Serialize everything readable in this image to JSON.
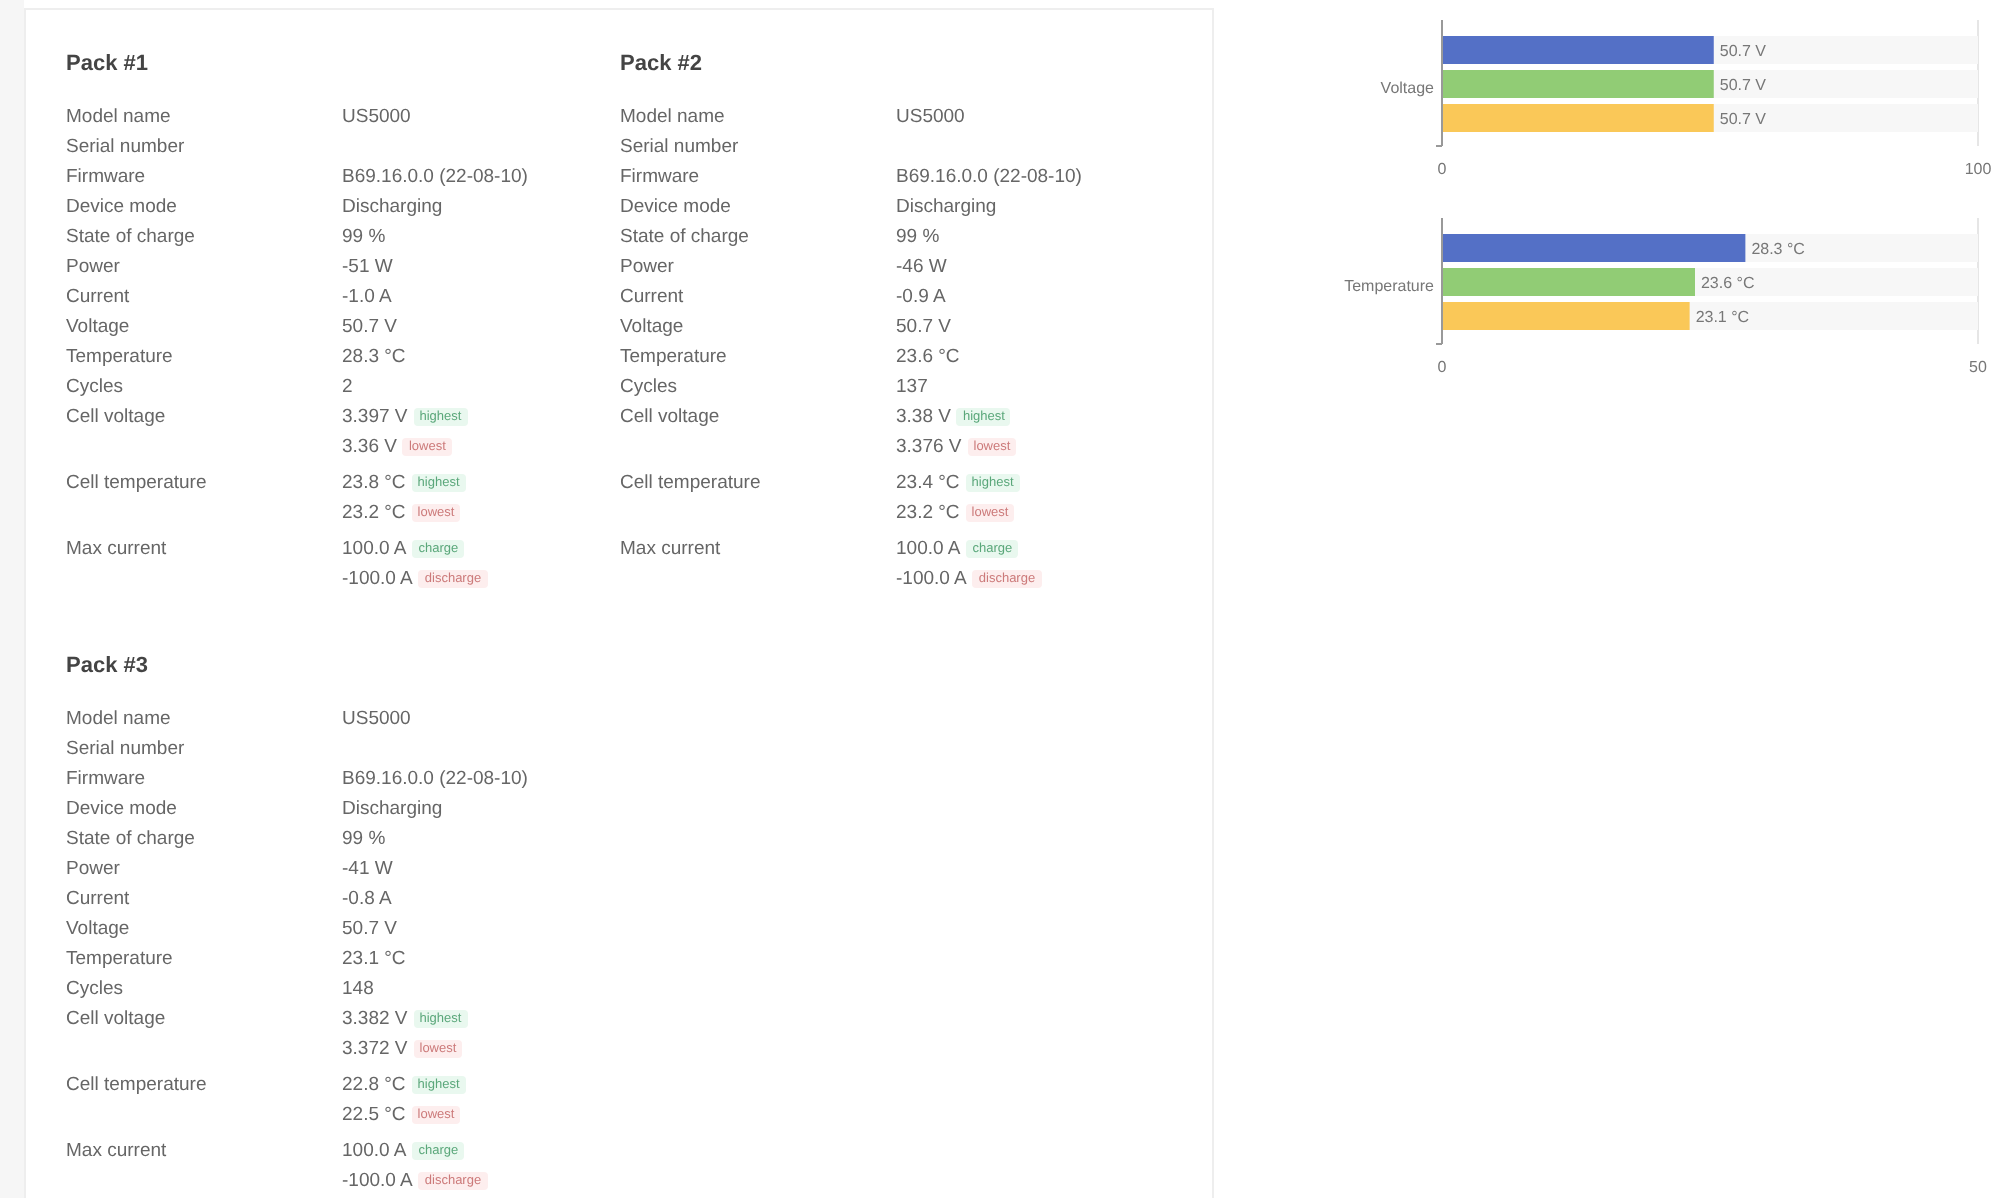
{
  "packs": [
    {
      "title": "Pack #1",
      "rows": [
        {
          "label": "Model name",
          "values": [
            {
              "text": "US5000"
            }
          ]
        },
        {
          "label": "Serial number",
          "values": []
        },
        {
          "label": "Firmware",
          "values": [
            {
              "text": "B69.16.0.0 (22-08-10)"
            }
          ]
        },
        {
          "label": "Device mode",
          "values": [
            {
              "text": "Discharging"
            }
          ]
        },
        {
          "label": "State of charge",
          "values": [
            {
              "text": "99 %"
            }
          ]
        },
        {
          "label": "Power",
          "values": [
            {
              "text": "-51 W"
            }
          ]
        },
        {
          "label": "Current",
          "values": [
            {
              "text": "-1.0 A"
            }
          ]
        },
        {
          "label": "Voltage",
          "values": [
            {
              "text": "50.7 V"
            }
          ]
        },
        {
          "label": "Temperature",
          "values": [
            {
              "text": "28.3 °C"
            }
          ]
        },
        {
          "label": "Cycles",
          "values": [
            {
              "text": "2"
            }
          ]
        },
        {
          "label": "Cell voltage",
          "values": [
            {
              "text": "3.397 V",
              "tag": "highest",
              "kind": "high"
            },
            {
              "text": "3.36 V",
              "tag": "lowest",
              "kind": "low"
            }
          ]
        },
        {
          "label": "Cell temperature",
          "values": [
            {
              "text": "23.8 °C",
              "tag": "highest",
              "kind": "high"
            },
            {
              "text": "23.2 °C",
              "tag": "lowest",
              "kind": "low"
            }
          ]
        },
        {
          "label": "Max current",
          "values": [
            {
              "text": "100.0 A",
              "tag": "charge",
              "kind": "high"
            },
            {
              "text": "-100.0 A",
              "tag": "discharge",
              "kind": "low"
            }
          ]
        }
      ]
    },
    {
      "title": "Pack #2",
      "rows": [
        {
          "label": "Model name",
          "values": [
            {
              "text": "US5000"
            }
          ]
        },
        {
          "label": "Serial number",
          "values": []
        },
        {
          "label": "Firmware",
          "values": [
            {
              "text": "B69.16.0.0 (22-08-10)"
            }
          ]
        },
        {
          "label": "Device mode",
          "values": [
            {
              "text": "Discharging"
            }
          ]
        },
        {
          "label": "State of charge",
          "values": [
            {
              "text": "99 %"
            }
          ]
        },
        {
          "label": "Power",
          "values": [
            {
              "text": "-46 W"
            }
          ]
        },
        {
          "label": "Current",
          "values": [
            {
              "text": "-0.9 A"
            }
          ]
        },
        {
          "label": "Voltage",
          "values": [
            {
              "text": "50.7 V"
            }
          ]
        },
        {
          "label": "Temperature",
          "values": [
            {
              "text": "23.6 °C"
            }
          ]
        },
        {
          "label": "Cycles",
          "values": [
            {
              "text": "137"
            }
          ]
        },
        {
          "label": "Cell voltage",
          "values": [
            {
              "text": "3.38 V",
              "tag": "highest",
              "kind": "high"
            },
            {
              "text": "3.376 V",
              "tag": "lowest",
              "kind": "low"
            }
          ]
        },
        {
          "label": "Cell temperature",
          "values": [
            {
              "text": "23.4 °C",
              "tag": "highest",
              "kind": "high"
            },
            {
              "text": "23.2 °C",
              "tag": "lowest",
              "kind": "low"
            }
          ]
        },
        {
          "label": "Max current",
          "values": [
            {
              "text": "100.0 A",
              "tag": "charge",
              "kind": "high"
            },
            {
              "text": "-100.0 A",
              "tag": "discharge",
              "kind": "low"
            }
          ]
        }
      ]
    },
    {
      "title": "Pack #3",
      "rows": [
        {
          "label": "Model name",
          "values": [
            {
              "text": "US5000"
            }
          ]
        },
        {
          "label": "Serial number",
          "values": []
        },
        {
          "label": "Firmware",
          "values": [
            {
              "text": "B69.16.0.0 (22-08-10)"
            }
          ]
        },
        {
          "label": "Device mode",
          "values": [
            {
              "text": "Discharging"
            }
          ]
        },
        {
          "label": "State of charge",
          "values": [
            {
              "text": "99 %"
            }
          ]
        },
        {
          "label": "Power",
          "values": [
            {
              "text": "-41 W"
            }
          ]
        },
        {
          "label": "Current",
          "values": [
            {
              "text": "-0.8 A"
            }
          ]
        },
        {
          "label": "Voltage",
          "values": [
            {
              "text": "50.7 V"
            }
          ]
        },
        {
          "label": "Temperature",
          "values": [
            {
              "text": "23.1 °C"
            }
          ]
        },
        {
          "label": "Cycles",
          "values": [
            {
              "text": "148"
            }
          ]
        },
        {
          "label": "Cell voltage",
          "values": [
            {
              "text": "3.382 V",
              "tag": "highest",
              "kind": "high"
            },
            {
              "text": "3.372 V",
              "tag": "lowest",
              "kind": "low"
            }
          ]
        },
        {
          "label": "Cell temperature",
          "values": [
            {
              "text": "22.8 °C",
              "tag": "highest",
              "kind": "high"
            },
            {
              "text": "22.5 °C",
              "tag": "lowest",
              "kind": "low"
            }
          ]
        },
        {
          "label": "Max current",
          "values": [
            {
              "text": "100.0 A",
              "tag": "charge",
              "kind": "high"
            },
            {
              "text": "-100.0 A",
              "tag": "discharge",
              "kind": "low"
            }
          ]
        }
      ]
    }
  ],
  "charts": [
    {
      "chart_data": {
        "type": "bar",
        "orientation": "horizontal",
        "categories": [
          "Voltage"
        ],
        "xlim": [
          0,
          100
        ],
        "xticks": [
          0,
          100
        ],
        "series": [
          {
            "color": "#5470c6",
            "values": [
              50.7
            ]
          },
          {
            "color": "#91cc75",
            "values": [
              50.7
            ]
          },
          {
            "color": "#fac858",
            "values": [
              50.7
            ]
          }
        ],
        "value_labels": [
          [
            "50.7 V"
          ],
          [
            "50.7 V"
          ],
          [
            "50.7 V"
          ]
        ]
      }
    },
    {
      "chart_data": {
        "type": "bar",
        "orientation": "horizontal",
        "categories": [
          "Temperature"
        ],
        "xlim": [
          0,
          50
        ],
        "xticks": [
          0,
          50
        ],
        "series": [
          {
            "color": "#5470c6",
            "values": [
              28.3
            ]
          },
          {
            "color": "#91cc75",
            "values": [
              23.6
            ]
          },
          {
            "color": "#fac858",
            "values": [
              23.1
            ]
          }
        ],
        "value_labels": [
          [
            "28.3 °C"
          ],
          [
            "23.6 °C"
          ],
          [
            "23.1 °C"
          ]
        ]
      }
    }
  ]
}
